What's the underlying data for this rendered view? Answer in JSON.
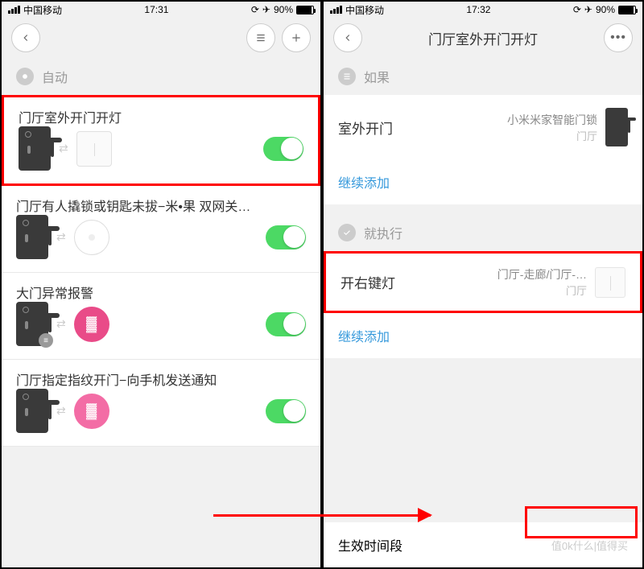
{
  "left": {
    "status": {
      "carrier": "中国移动",
      "time": "17:31",
      "battery": "90%"
    },
    "section_label": "自动",
    "rules": [
      {
        "title": "门厅室外开门开灯"
      },
      {
        "title": "门厅有人撬锁或钥匙未拔−米•果 双网关…"
      },
      {
        "title": "大门异常报警"
      },
      {
        "title": "门厅指定指纹开门−向手机发送通知"
      }
    ]
  },
  "right": {
    "status": {
      "carrier": "中国移动",
      "time": "17:32",
      "battery": "90%"
    },
    "title": "门厅室外开门开灯",
    "section_if": "如果",
    "trigger": {
      "label": "室外开门",
      "device": "小米米家智能门锁",
      "room": "门厅"
    },
    "add_more": "继续添加",
    "section_then": "就执行",
    "action": {
      "label": "开右键灯",
      "device": "门厅-走廊/门厅-…",
      "room": "门厅"
    },
    "effective": "生效时间段",
    "effective_value": "值0k什么|值得买"
  }
}
